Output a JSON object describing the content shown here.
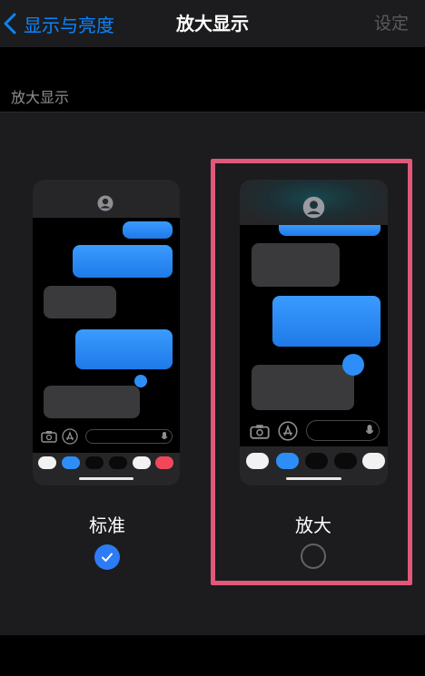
{
  "nav": {
    "back_label": "显示与亮度",
    "title": "放大显示",
    "right_label": "设定"
  },
  "section": {
    "title": "放大显示"
  },
  "options": [
    {
      "label": "标准",
      "selected": true
    },
    {
      "label": "放大",
      "selected": false
    }
  ],
  "colors": {
    "accent": "#0a84ff",
    "highlight_border": "#e0587a",
    "bubble_blue": "#2d8ef7",
    "bubble_gray": "#3a3a3c",
    "panel_bg": "#1c1c1e"
  },
  "icons": {
    "back": "chevron-left-icon",
    "avatar": "person-circle-icon",
    "camera": "camera-icon",
    "appstore": "app-store-icon",
    "mic": "microphone-icon",
    "check": "checkmark-icon"
  }
}
